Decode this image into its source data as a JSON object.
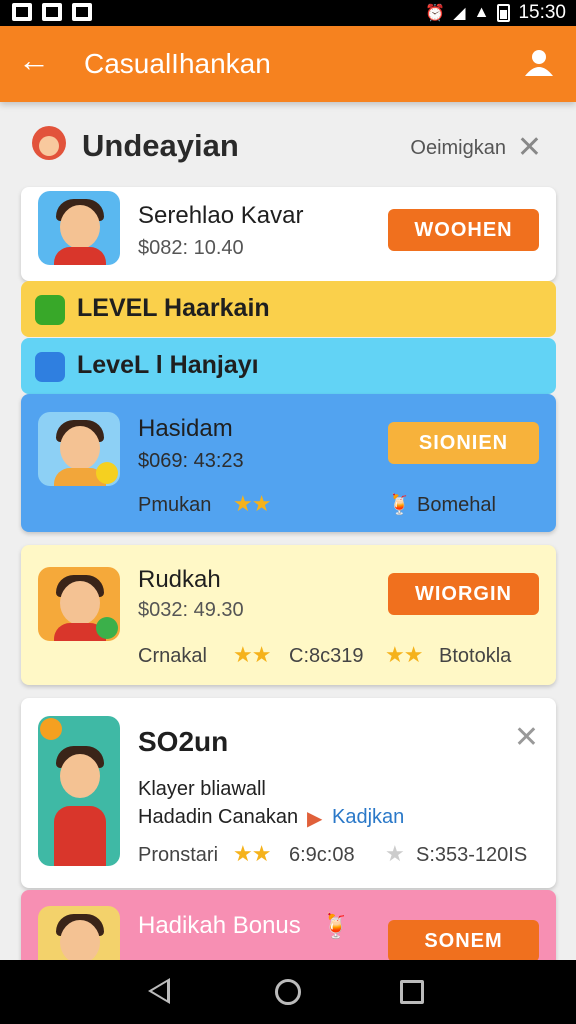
{
  "status_bar": {
    "time": "15:30"
  },
  "app_bar": {
    "title": "CasualIhankan",
    "back_icon": "arrow-left-icon",
    "action_icon": "person-icon"
  },
  "header": {
    "title": "Undeayian",
    "link": "Oeimigkan"
  },
  "cards": [
    {
      "title": "Serehlao Kavar",
      "price": "$082: 10.40",
      "button": "WOOHEN",
      "button_color": "#f0701e"
    },
    {
      "title": "Hasidam",
      "price": "$069: 43:23",
      "button": "SIONIEN",
      "button_color": "#f7b23b",
      "meta_left": "Pmukan",
      "meta_right": "Bomehal"
    },
    {
      "title": "Rudkah",
      "price": "$032: 49.30",
      "button": "WIORGIN",
      "button_color": "#f0701e",
      "meta_left": "Crnakal",
      "meta_mid": "C:8c319",
      "meta_right": "Btotokla"
    },
    {
      "title": "SO2un",
      "line1": "Klayer bliawall",
      "line2": "Hadadin Canakan",
      "link": "Kadjkan",
      "meta_left": "Pronstari",
      "meta_mid": "6:9c:08",
      "meta_right": "S:353-120IS"
    },
    {
      "title": "Hadikah Bonus",
      "button": "SONEM",
      "button_color": "#f0701e"
    }
  ],
  "levels": [
    {
      "label": "LEVEL Haarkain",
      "color": "#fad04b",
      "icon_color": "#38a829"
    },
    {
      "label": "LeveL l Hanjayı",
      "color": "#62d3f5",
      "icon_color": "#2f7fe0"
    }
  ],
  "colors": {
    "accent": "#f6821f",
    "blue_card": "#52a3f0",
    "yellow_card": "#fff8c6",
    "pink_card": "#f78fb3"
  }
}
